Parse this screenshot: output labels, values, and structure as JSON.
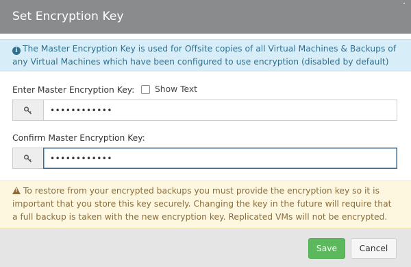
{
  "dialog": {
    "title": "Set Encryption Key"
  },
  "info_alert": {
    "text": "The Master Encryption Key is used for Offsite copies of all Virtual Machines & Backups of any Virtual Machines which have been configured to use encryption (disabled by default)"
  },
  "master_key": {
    "label": "Enter Master Encryption Key:",
    "show_text_label": "Show Text",
    "value": "••••••••••••",
    "icon": "key-icon"
  },
  "confirm_key": {
    "label": "Confirm Master Encryption Key:",
    "value": "••••••••••••",
    "icon": "key-icon"
  },
  "warning_alert": {
    "text": "To restore from your encrypted backups you must provide the encryption key so it is important that you store this key securely. Changing the key in the future will require that a full backup is taken with the new encryption key. Replicated VMs will not be encrypted."
  },
  "footer": {
    "save_label": "Save",
    "cancel_label": "Cancel"
  },
  "colors": {
    "header": "#898b8d",
    "info": "#d7edf8",
    "warning": "#fcf7de",
    "save": "#5cb85c"
  }
}
